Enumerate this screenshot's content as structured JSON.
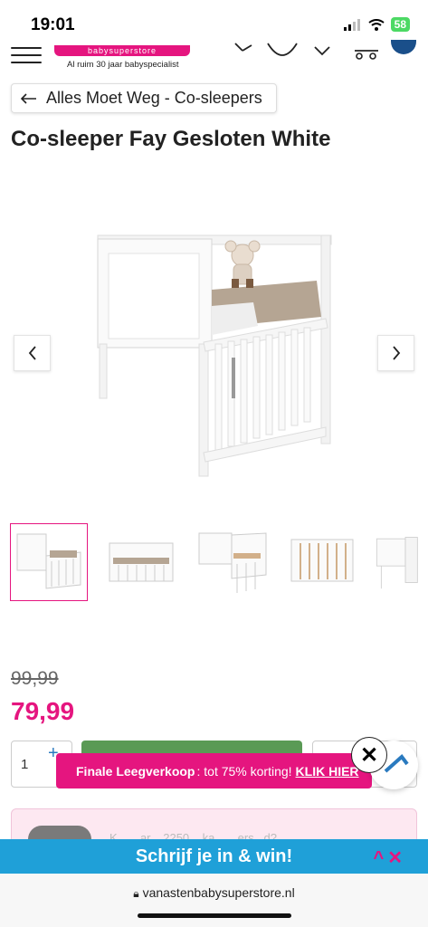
{
  "status": {
    "time": "19:01",
    "battery": "58"
  },
  "header": {
    "logo_text": "babysuperstore",
    "logo_tagline": "Al ruim 30 jaar babyspecialist"
  },
  "breadcrumb": {
    "label": "Alles Moet Weg - Co-sleepers"
  },
  "product": {
    "title": "Co-sleeper Fay Gesloten White",
    "old_price": "99,99",
    "price": "79,99",
    "quantity": "1"
  },
  "promo": {
    "bold": "Finale Leegverkoop",
    "text": ": tot 75% korting!",
    "link": "KLIK HIER"
  },
  "faint": {
    "text": "K... ...ar... 2250 ...ka... ...ers...d?"
  },
  "signup": {
    "label": "Schrijf je in & win!"
  },
  "browser": {
    "url": "vanastenbabysuperstore.nl"
  },
  "colors": {
    "brand": "#e5157f",
    "signup_bg": "#1fa0d8",
    "add_button": "#5a9a55"
  }
}
